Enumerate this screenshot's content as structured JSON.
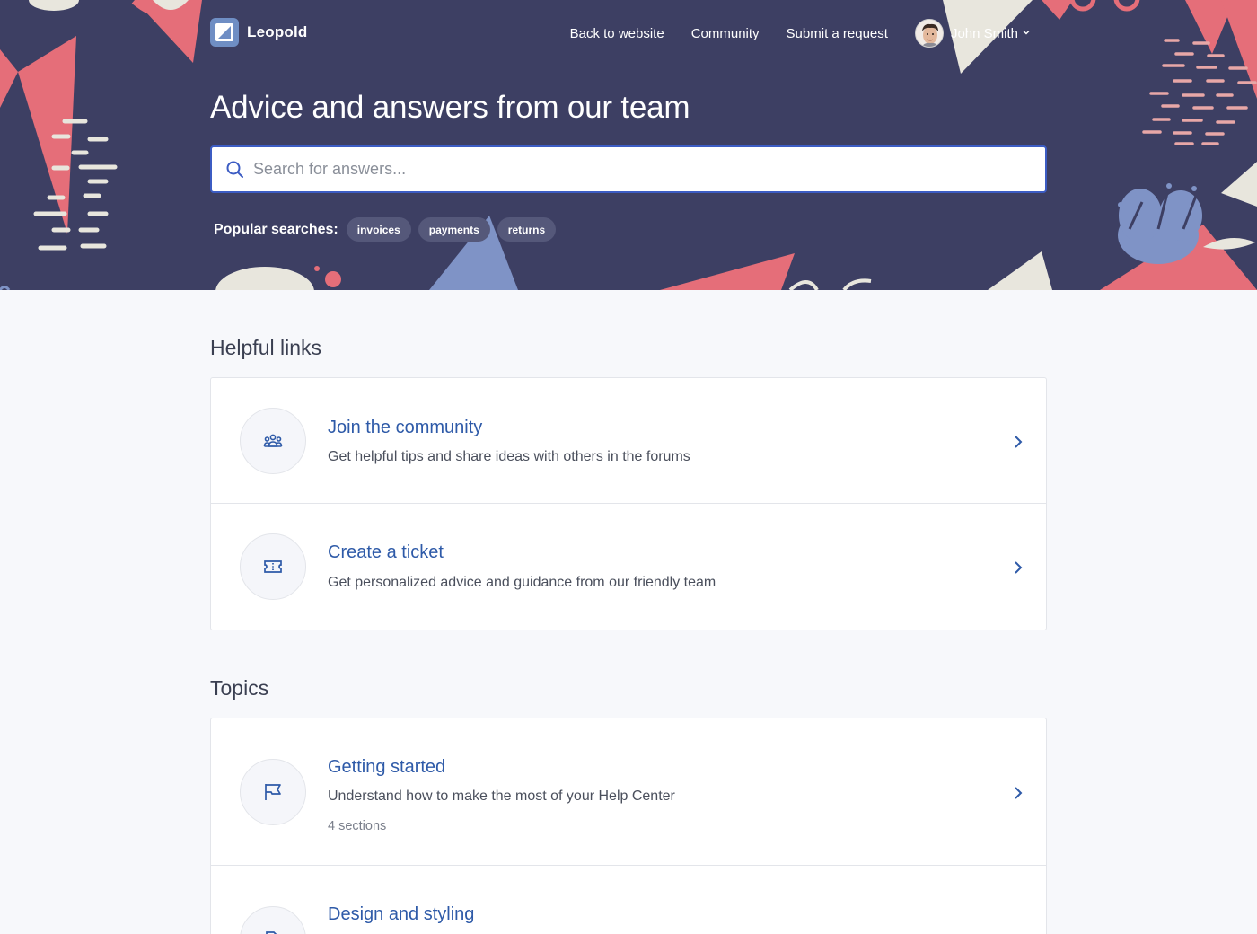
{
  "brand": {
    "name": "Leopold"
  },
  "nav": {
    "back_to_website": "Back to website",
    "community": "Community",
    "submit_request": "Submit a request",
    "user_name": "John Smith"
  },
  "hero": {
    "title": "Advice and answers from our team",
    "search_placeholder": "Search for answers...",
    "popular_label": "Popular searches:",
    "popular_searches": [
      "invoices",
      "payments",
      "returns"
    ]
  },
  "helpful_links": {
    "heading": "Helpful links",
    "items": [
      {
        "icon": "community-icon",
        "title": "Join the community",
        "description": "Get helpful tips and share ideas with others in the forums"
      },
      {
        "icon": "ticket-icon",
        "title": "Create a ticket",
        "description": "Get personalized advice and guidance from our friendly team"
      }
    ]
  },
  "topics": {
    "heading": "Topics",
    "items": [
      {
        "icon": "flag-icon",
        "title": "Getting started",
        "description": "Understand how to make the most of your Help Center",
        "meta": "4 sections"
      },
      {
        "icon": "brush-icon",
        "title": "Design and styling"
      }
    ]
  },
  "colors": {
    "hero_bg": "#3d3f63",
    "accent": "#2e5aa8",
    "search_border": "#3c5cc3",
    "shape_red": "#e56e79",
    "shape_blue": "#7f93c6",
    "shape_cream": "#e8e6dd"
  }
}
